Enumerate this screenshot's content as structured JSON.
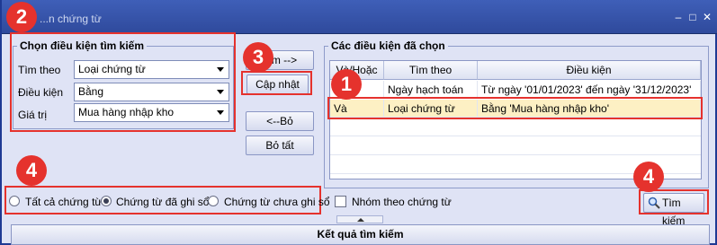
{
  "window": {
    "title": "...n chứng từ",
    "controls": [
      "minimize-icon",
      "maximize-icon",
      "close-icon"
    ]
  },
  "annotations": {
    "badge_1": "1",
    "badge_2": "2",
    "badge_3": "3",
    "badge_4a": "4",
    "badge_4b": "4",
    "color": "#e5322d"
  },
  "criteria": {
    "legend": "Chọn điều kiện tìm kiếm",
    "search_by_label": "Tìm theo",
    "search_by_value": "Loại chứng từ",
    "condition_label": "Điều kiện",
    "condition_value": "Bằng",
    "value_label": "Giá trị",
    "value_value": "Mua hàng nhập kho"
  },
  "middle_buttons": {
    "add": "...m -->",
    "update": "Cập nhật",
    "remove": "<--Bỏ",
    "remove_all": "Bỏ tất"
  },
  "selected": {
    "legend": "Các điều kiện đã chọn",
    "columns": [
      "Và/Hoặc",
      "Tìm theo",
      "Điều kiện"
    ],
    "rows": [
      {
        "andor": "",
        "field": "Ngày hạch toán",
        "condition": "Từ ngày '01/01/2023' đến ngày '31/12/2023'"
      },
      {
        "andor": "Và",
        "field": "Loại chứng từ",
        "condition": "Bằng 'Mua hàng nhập kho'"
      }
    ]
  },
  "filter": {
    "all_docs": "Tất cả chứng từ",
    "posted": "Chứng từ đã ghi sổ",
    "unposted": "Chứng từ chưa ghi sổ",
    "selected_option": "posted",
    "group_by": "Nhóm theo chứng từ",
    "group_checked": false
  },
  "search_button": "Tìm kiếm",
  "results_header": "Kết quả tìm kiếm"
}
